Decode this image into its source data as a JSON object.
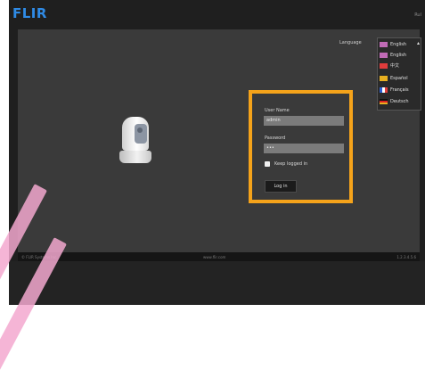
{
  "header": {
    "logo": "FLIR",
    "top_right": "Rul"
  },
  "language": {
    "label": "Language",
    "options": [
      {
        "label": "English",
        "flag_color": "#c06bb6"
      },
      {
        "label": "English",
        "flag_color": "#c06bb6"
      },
      {
        "label": "中文",
        "flag_color": "#e03c3c"
      },
      {
        "label": "Español",
        "flag_color": "#e8b020"
      },
      {
        "label": "Français",
        "flag_color": "#2c5fd1"
      },
      {
        "label": "Deutsch",
        "flag_color": "#e8a020"
      }
    ]
  },
  "login": {
    "username_label": "User Name",
    "username_value": "admin",
    "password_label": "Password",
    "password_value": "•••",
    "keep_logged_in_label": "Keep logged in",
    "login_button": "Log in",
    "highlight_color": "#f5a31a"
  },
  "footer": {
    "left": "© FLIR Systems Inc.",
    "center": "www.flir.com",
    "right": "1.2.3.4.5.6"
  }
}
